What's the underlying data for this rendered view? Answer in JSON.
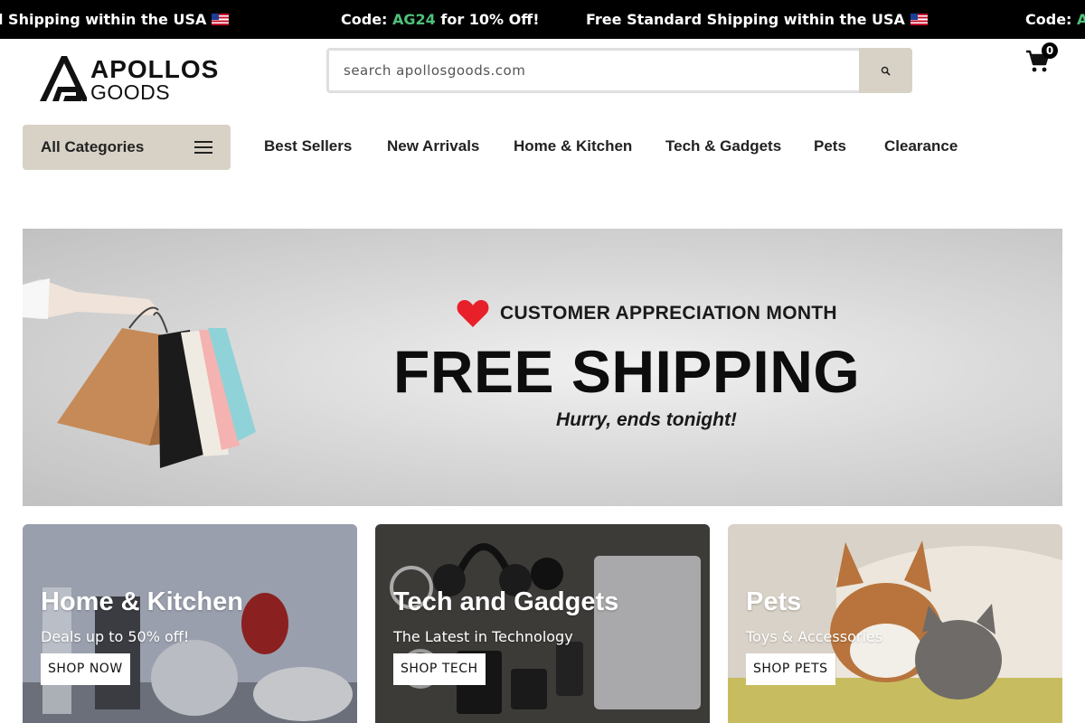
{
  "announcement_bar": {
    "items": [
      {
        "before": "l Shipping within the USA",
        "code": "",
        "after": ""
      },
      {
        "before": "Code: ",
        "code": "AG24",
        "after": " for 10% Off!"
      },
      {
        "before": "Free Standard Shipping within the USA",
        "code": "",
        "after": ""
      },
      {
        "before": "Code: ",
        "code": "AG",
        "after": ""
      }
    ],
    "code_color": "#4fc07a"
  },
  "logo": {
    "line1": "APOLLOS",
    "line2": "GOODS"
  },
  "search": {
    "placeholder": "search apollosgoods.com",
    "button_icon": "search-icon"
  },
  "cart": {
    "count": "0",
    "icon": "cart-icon"
  },
  "nav": {
    "categories_label": "All Categories",
    "categories_icon": "hamburger-icon",
    "links": [
      "Best Sellers",
      "New Arrivals",
      "Home & Kitchen",
      "Tech & Gadgets",
      "Pets",
      "Clearance"
    ]
  },
  "hero": {
    "tagline": "CUSTOMER APPRECIATION MONTH",
    "title": "FREE SHIPPING",
    "subtitle": "Hurry, ends tonight!",
    "heart_color": "#e8202a"
  },
  "cards": [
    {
      "title": "Home & Kitchen",
      "subtitle": "Deals up to 50% off!",
      "button": "SHOP NOW"
    },
    {
      "title": "Tech and Gadgets",
      "subtitle": "The Latest in Technology",
      "button": "SHOP TECH"
    },
    {
      "title": "Pets",
      "subtitle": "Toys & Accessories",
      "button": "SHOP PETS"
    }
  ],
  "colors": {
    "accent_tan": "#d8d2c6",
    "announcement_bg": "#000000"
  }
}
